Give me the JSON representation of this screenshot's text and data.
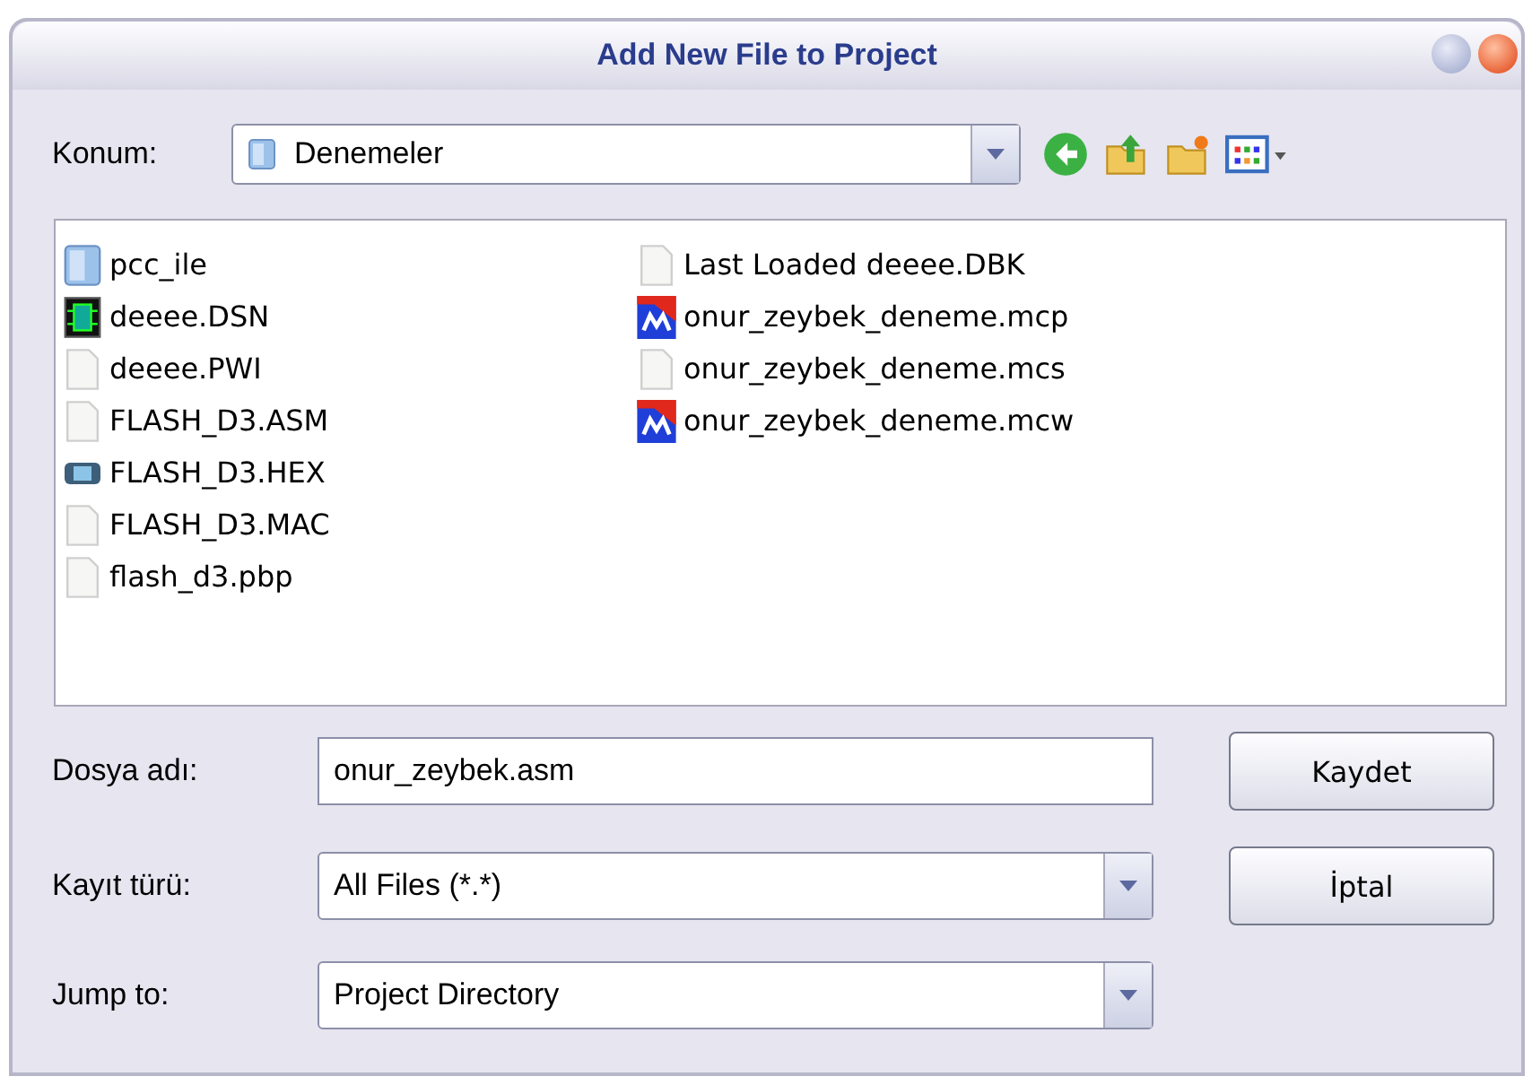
{
  "window": {
    "title": "Add New File to Project"
  },
  "location": {
    "label": "Konum:",
    "value": "Denemeler"
  },
  "files": [
    {
      "name": "pcc_ile",
      "kind": "folder"
    },
    {
      "name": "deeee.DSN",
      "kind": "schematic"
    },
    {
      "name": "deeee.PWI",
      "kind": "document"
    },
    {
      "name": "FLASH_D3.ASM",
      "kind": "document"
    },
    {
      "name": "FLASH_D3.HEX",
      "kind": "chip"
    },
    {
      "name": "FLASH_D3.MAC",
      "kind": "document"
    },
    {
      "name": "flash_d3.pbp",
      "kind": "document"
    },
    {
      "name": "Last Loaded deeee.DBK",
      "kind": "document"
    },
    {
      "name": "onur_zeybek_deneme.mcp",
      "kind": "project"
    },
    {
      "name": "onur_zeybek_deneme.mcs",
      "kind": "document"
    },
    {
      "name": "onur_zeybek_deneme.mcw",
      "kind": "project"
    }
  ],
  "filename": {
    "label": "Dosya adı:",
    "value": "onur_zeybek.asm"
  },
  "filetype": {
    "label": "Kayıt türü:",
    "value": "All Files (*.*)"
  },
  "jump_to": {
    "label": "Jump to:",
    "value": "Project Directory"
  },
  "buttons": [
    "Kaydet",
    "İptal"
  ]
}
